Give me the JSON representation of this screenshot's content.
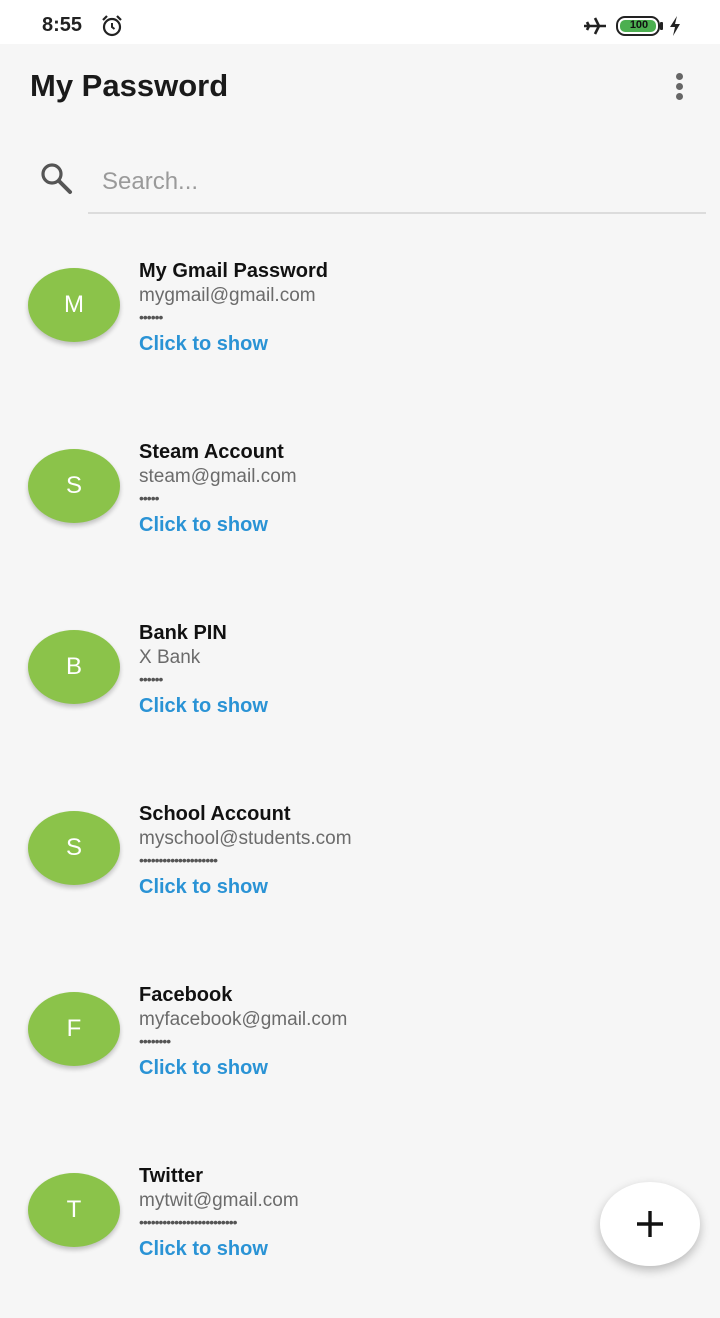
{
  "status_bar": {
    "time": "8:55",
    "battery": "100",
    "icons": [
      "alarm-icon",
      "airplane-icon",
      "battery-icon",
      "charging-icon"
    ]
  },
  "app_bar": {
    "title": "My Password",
    "menu_icon": "more-vert-icon"
  },
  "search": {
    "placeholder": "Search...",
    "value": "",
    "icon": "search-icon"
  },
  "accent_color": "#8bc34a",
  "link_color": "#2a93d5",
  "entries": [
    {
      "initial": "M",
      "title": "My Gmail Password",
      "subtitle": "mygmail@gmail.com",
      "masked": "••••••",
      "action": "Click to show"
    },
    {
      "initial": "S",
      "title": "Steam Account",
      "subtitle": "steam@gmail.com",
      "masked": "•••••",
      "action": "Click to show"
    },
    {
      "initial": "B",
      "title": "Bank PIN",
      "subtitle": "X Bank",
      "masked": "••••••",
      "action": "Click to show"
    },
    {
      "initial": "S",
      "title": "School Account",
      "subtitle": "myschool@students.com",
      "masked": "••••••••••••••••••••",
      "action": "Click to show"
    },
    {
      "initial": "F",
      "title": "Facebook",
      "subtitle": "myfacebook@gmail.com",
      "masked": "••••••••",
      "action": "Click to show"
    },
    {
      "initial": "T",
      "title": "Twitter",
      "subtitle": "mytwit@gmail.com",
      "masked": "•••••••••••••••••••••••••",
      "action": "Click to show"
    }
  ],
  "fab": {
    "icon": "plus-icon"
  }
}
